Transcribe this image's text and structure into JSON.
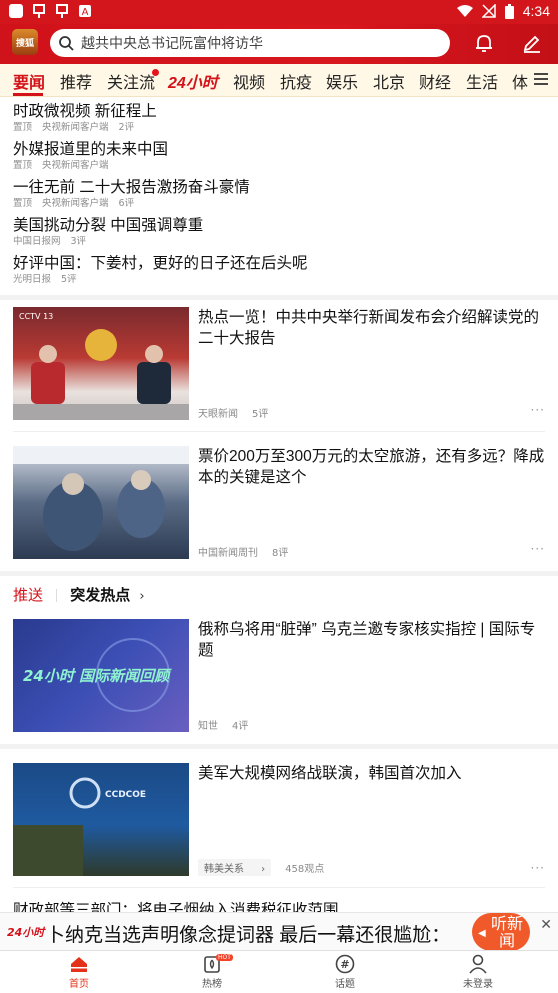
{
  "status_bar": {
    "time": "4:34"
  },
  "header": {
    "logo_text": "搜狐",
    "search_placeholder": "越共中央总书记阮富仲将访华"
  },
  "tabs": [
    "要闻",
    "推荐",
    "关注流",
    "24小时",
    "视频",
    "抗疫",
    "娱乐",
    "北京",
    "财经",
    "生活",
    "体"
  ],
  "headlines": [
    {
      "title": "时政微视频 新征程上",
      "tag": "置顶",
      "source": "央视新闻客户端",
      "comments": "2评"
    },
    {
      "title": "外媒报道里的未来中国",
      "tag": "置顶",
      "source": "央视新闻客户端",
      "comments": ""
    },
    {
      "title": "一往无前 二十大报告激扬奋斗豪情",
      "tag": "置顶",
      "source": "央视新闻客户端",
      "comments": "6评"
    },
    {
      "title": "美国挑动分裂 中国强调尊重",
      "tag": "",
      "source": "中国日报网",
      "comments": "3评"
    },
    {
      "title": "好评中国：下姜村，更好的日子还在后头呢",
      "tag": "",
      "source": "光明日报",
      "comments": "5评"
    }
  ],
  "cards": [
    {
      "title": "热点一览！中共中央举行新闻发布会介绍解读党的二十大报告",
      "source": "天眼新闻",
      "comments": "5评",
      "thumb_text": "CCTV 13"
    },
    {
      "title": "票价200万至300万元的太空旅游，还有多远？降成本的关键是这个",
      "source": "中国新闻周刊",
      "comments": "8评",
      "thumb_text": ""
    }
  ],
  "hot_section": {
    "label": "推送",
    "title": "突发热点"
  },
  "cards2": [
    {
      "title": "俄称乌将用“脏弹” 乌克兰邀专家核实指控 | 国际专题",
      "source": "知世",
      "comments": "4评",
      "thumb_text": "24小时 国际新闻回顾"
    },
    {
      "title": "美军大规模网络战联演，韩国首次加入",
      "tag": "韩美关系",
      "views": "458观点",
      "thumb_text": "CCDCOE"
    }
  ],
  "partial_headline": "财政部等三部门：将电子烟纳入消费税征收范围",
  "promo": {
    "logo": "24小时",
    "text": "卜纳克当选声明像念提词器 最后一幕还很尴尬：",
    "listen_label": "听新闻"
  },
  "bottom_nav": [
    {
      "label": "首页",
      "icon": "home-icon"
    },
    {
      "label": "热榜",
      "icon": "hot-list-icon",
      "badge": "HOT"
    },
    {
      "label": "话题",
      "icon": "hashtag-icon"
    },
    {
      "label": "未登录",
      "icon": "user-icon"
    }
  ],
  "colors": {
    "brand_red": "#d3151c",
    "tab_active": "#d4121a",
    "listen_orange": "#f05a2a"
  }
}
